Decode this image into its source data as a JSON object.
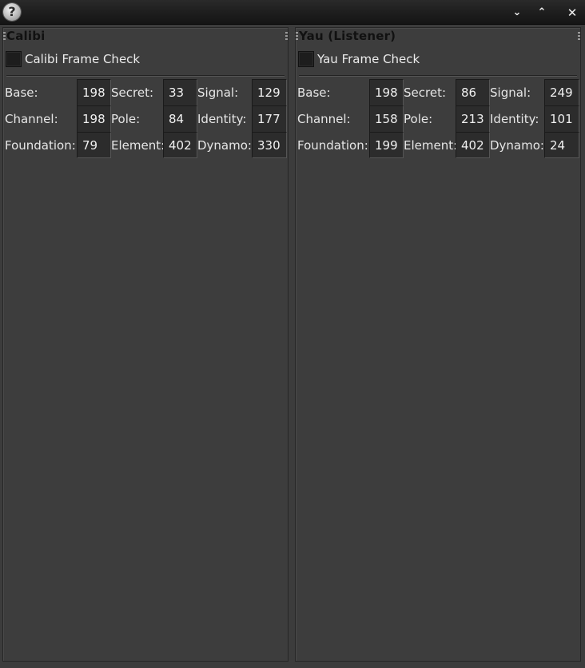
{
  "window": {
    "help_icon": "question-mark-icon",
    "minimize_glyph": "⌄",
    "maximize_glyph": "⌃",
    "close_glyph": "✕"
  },
  "panels": [
    {
      "title": "Calibi",
      "check_label": "Calibi Frame Check",
      "rows": [
        [
          {
            "label": "Base:",
            "value": "198"
          },
          {
            "label": "Secret:",
            "value": "33"
          },
          {
            "label": "Signal:",
            "value": "129"
          }
        ],
        [
          {
            "label": "Channel:",
            "value": "198"
          },
          {
            "label": "Pole:",
            "value": "84"
          },
          {
            "label": "Identity:",
            "value": "177"
          }
        ],
        [
          {
            "label": "Foundation:",
            "value": "79"
          },
          {
            "label": "Element:",
            "value": "402"
          },
          {
            "label": "Dynamo:",
            "value": "330"
          }
        ]
      ]
    },
    {
      "title": "Yau (Listener)",
      "check_label": "Yau Frame Check",
      "rows": [
        [
          {
            "label": "Base:",
            "value": "198"
          },
          {
            "label": "Secret:",
            "value": "86"
          },
          {
            "label": "Signal:",
            "value": "249"
          }
        ],
        [
          {
            "label": "Channel:",
            "value": "158"
          },
          {
            "label": "Pole:",
            "value": "213"
          },
          {
            "label": "Identity:",
            "value": "101"
          }
        ],
        [
          {
            "label": "Foundation:",
            "value": "199"
          },
          {
            "label": "Element:",
            "value": "402"
          },
          {
            "label": "Dynamo:",
            "value": "24"
          }
        ]
      ]
    }
  ]
}
